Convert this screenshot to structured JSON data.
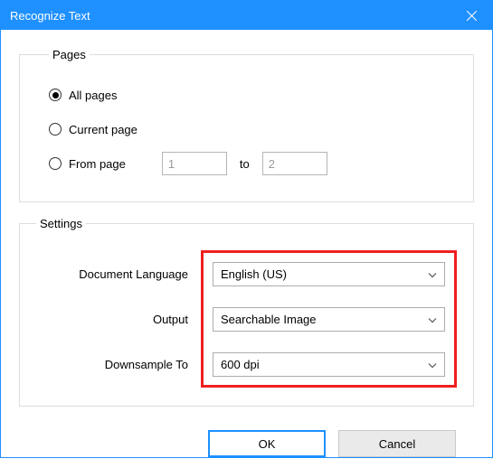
{
  "window": {
    "title": "Recognize Text"
  },
  "pages": {
    "legend": "Pages",
    "options": {
      "all": "All pages",
      "current": "Current page",
      "from": "From page",
      "to_label": "to",
      "from_value": "1",
      "to_value": "2"
    },
    "selected": "all"
  },
  "settings": {
    "legend": "Settings",
    "language": {
      "label": "Document Language",
      "value": "English (US)"
    },
    "output": {
      "label": "Output",
      "value": "Searchable Image"
    },
    "downsample": {
      "label": "Downsample To",
      "value": "600 dpi"
    }
  },
  "buttons": {
    "ok": "OK",
    "cancel": "Cancel"
  }
}
